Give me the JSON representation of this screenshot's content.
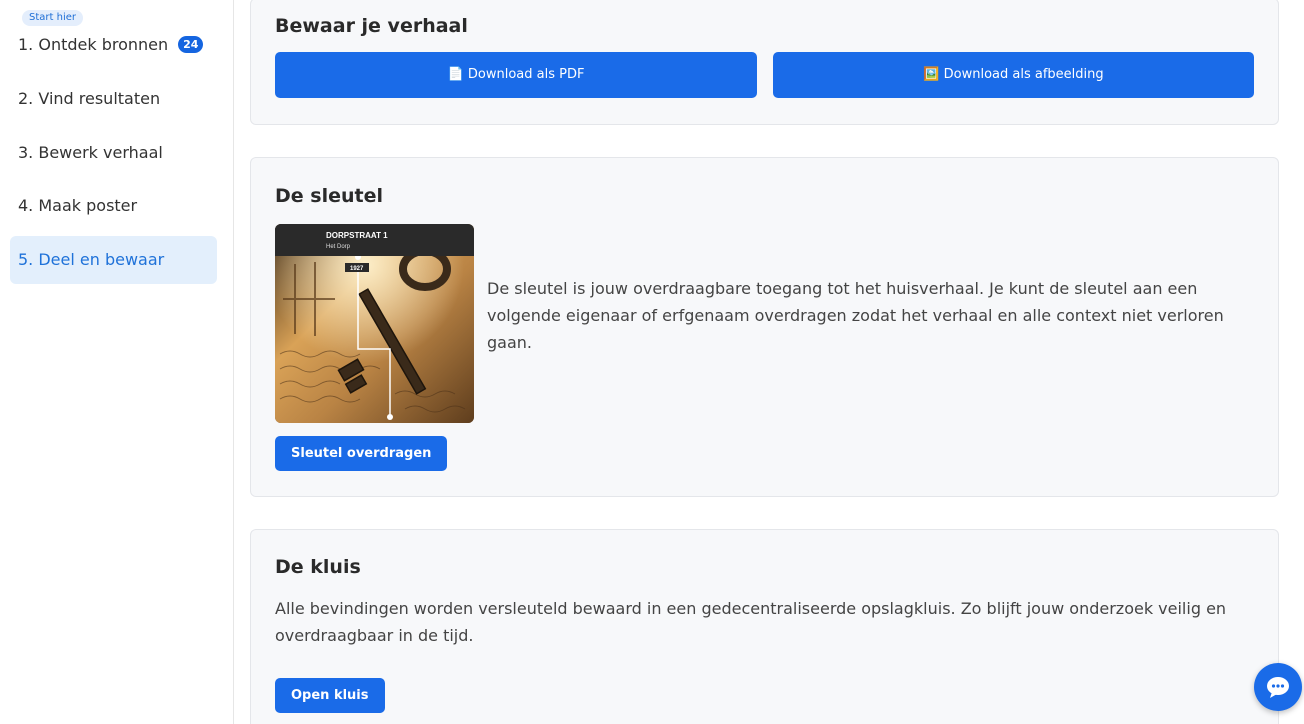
{
  "sidebar": {
    "start_badge": "Start hier",
    "items": [
      {
        "label": "1. Ontdek bronnen",
        "count": "24"
      },
      {
        "label": "2. Vind resultaten"
      },
      {
        "label": "3. Bewerk verhaal"
      },
      {
        "label": "4. Maak poster"
      },
      {
        "label": "5. Deel en bewaar"
      }
    ],
    "active_color": "#1f72d9"
  },
  "save_story": {
    "title": "Bewaar je verhaal",
    "pdf_icon": "📄",
    "pdf_label": "Download als PDF",
    "image_icon": "🖼️",
    "image_label": "Download als afbeelding"
  },
  "key": {
    "title": "De sleutel",
    "image": {
      "heading": "DORPSTRAAT 1",
      "subheading": "Het Dorp",
      "year": "1927"
    },
    "description": "De sleutel is jouw overdraagbare toegang tot het huisverhaal. Je kunt de sleutel aan een volgende eigenaar of erfgenaam overdragen zodat het verhaal en alle context niet verloren gaan.",
    "button": "Sleutel overdragen"
  },
  "vault": {
    "title": "De kluis",
    "description": "Alle bevindingen worden versleuteld bewaard in een gedecentraliseerde opslagkluis. Zo blijft jouw onderzoek veilig en overdraagbaar in de tijd.",
    "button": "Open kluis"
  },
  "chat": {
    "icon": "chat-bubble-icon"
  },
  "colors": {
    "primary": "#1a6be8",
    "badge": "#1565e0"
  }
}
